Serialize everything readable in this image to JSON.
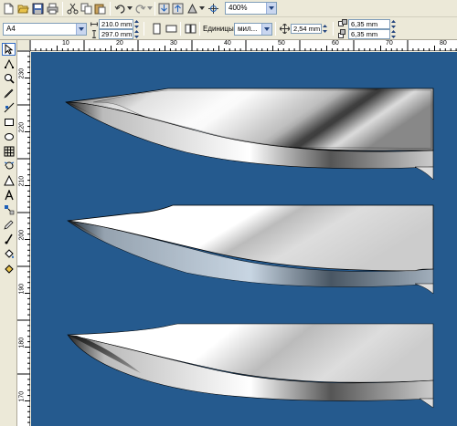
{
  "toolbar": {
    "zoom_value": "400%",
    "icons": [
      "new-icon",
      "open-icon",
      "save-icon",
      "print-icon",
      "cut-icon",
      "copy-icon",
      "paste-icon",
      "undo-icon",
      "redo-icon",
      "import-icon",
      "export-icon",
      "app-launcher-icon",
      "snap-icon"
    ]
  },
  "property_bar": {
    "paper_size": "A4",
    "width": "210.0 mm",
    "height": "297.0 mm",
    "units_label": "Единицы:",
    "units_value": "мил...",
    "nudge_value": "2,54 mm",
    "duplicate_x": "6,35 mm",
    "duplicate_y": "6,35 mm"
  },
  "ruler_h": {
    "labels": [
      "10",
      "20",
      "30",
      "40",
      "50",
      "60",
      "70",
      "80"
    ]
  },
  "ruler_v": {
    "labels": [
      "230",
      "220",
      "210",
      "200",
      "190",
      "180",
      "170"
    ]
  },
  "colors": {
    "canvas_bg": "#255a8e",
    "ui_bg": "#ece9d8",
    "accent": "#316ac5"
  }
}
